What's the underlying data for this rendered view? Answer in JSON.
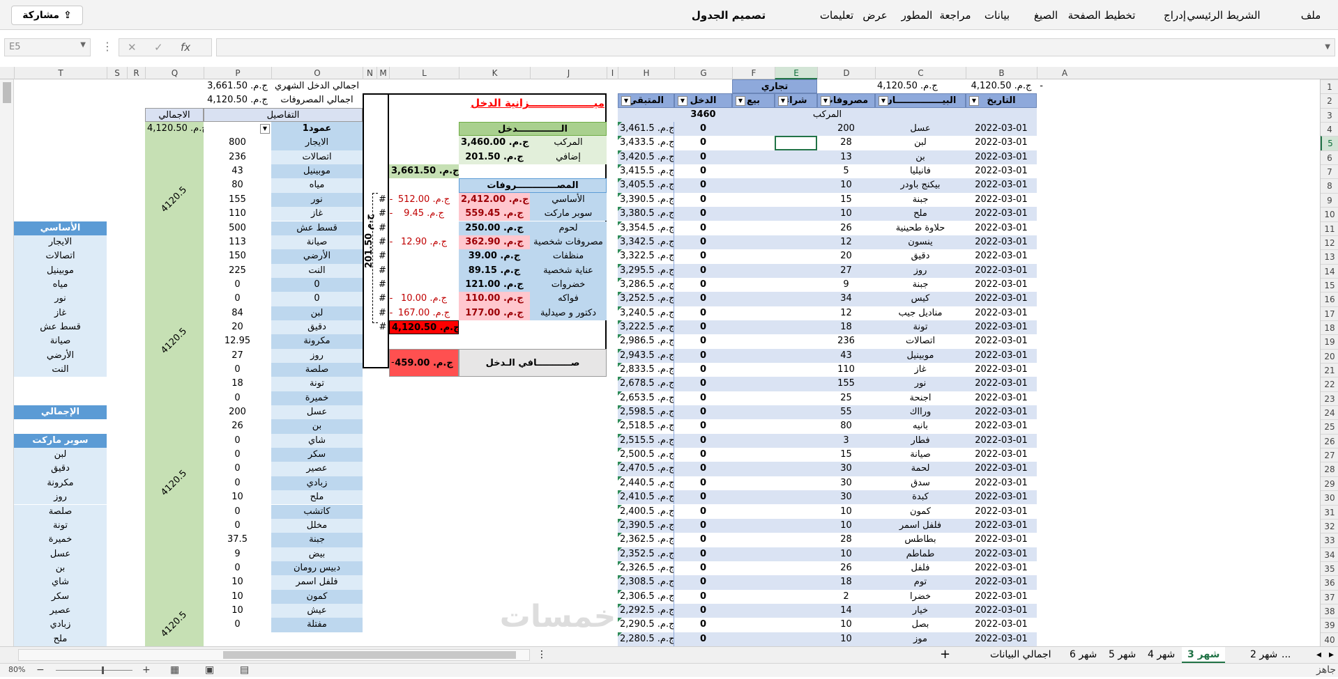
{
  "ribbon": {
    "share_label": "مشاركة",
    "tabs": [
      "ملف",
      "الشريط الرئيسي",
      "إدراج",
      "تخطيط الصفحة",
      "الصيغ",
      "بيانات",
      "مراجعة",
      "المطور",
      "عرض",
      "تعليمات",
      "تصميم الجدول"
    ]
  },
  "formula_bar": {
    "name_box": "E5",
    "cancel": "✕",
    "confirm": "✓",
    "fx": "fx",
    "value": ""
  },
  "columns": [
    "A",
    "B",
    "C",
    "D",
    "E",
    "F",
    "G",
    "H",
    "I",
    "J",
    "K",
    "L",
    "M",
    "N",
    "O",
    "P",
    "Q",
    "R",
    "S",
    "T"
  ],
  "rows": [
    "1",
    "2",
    "3",
    "4",
    "5",
    "6",
    "7",
    "8",
    "9",
    "10",
    "11",
    "12",
    "13",
    "14",
    "15",
    "16",
    "17",
    "18",
    "19",
    "20",
    "21",
    "22",
    "23",
    "24",
    "25",
    "26",
    "27",
    "28",
    "29",
    "30",
    "31",
    "32",
    "33",
    "34",
    "35",
    "36",
    "37",
    "38",
    "39",
    "40"
  ],
  "selected_cell": {
    "column": "E",
    "row": "5"
  },
  "top_summary": {
    "income_label": "اجمالي الدخل الشهري",
    "income_value": "ج.م. 3,661.50",
    "expenses_label": "اجمالي المصروفات",
    "expenses_value": "ج.م. 4,120.50",
    "balance_value": "ج.م. 4,120.50",
    "balance_dash": "-",
    "net_value": "ج.م. 459.00",
    "net_dash": "-",
    "commercial": "تجاري"
  },
  "main_table": {
    "headers": [
      "التاريخ",
      "البيـــــــــــــــان",
      "مصروفات",
      "شراء",
      "بيع",
      "الدخل",
      "المتبقي"
    ],
    "subheader": "المركب",
    "g3_value": "3460",
    "rows": [
      [
        "2022-03-01",
        "عسل",
        "200",
        "",
        "",
        "0",
        "ج.م. 3,461.5"
      ],
      [
        "2022-03-01",
        "لبن",
        "28",
        "",
        "",
        "0",
        "ج.م. 3,433.5"
      ],
      [
        "2022-03-01",
        "بن",
        "13",
        "",
        "",
        "0",
        "ج.م. 3,420.5"
      ],
      [
        "2022-03-01",
        "فانيليا",
        "5",
        "",
        "",
        "0",
        "ج.م. 3,415.5"
      ],
      [
        "2022-03-01",
        "بيكنج باودر",
        "10",
        "",
        "",
        "0",
        "ج.م. 3,405.5"
      ],
      [
        "2022-03-01",
        "جبنة",
        "15",
        "",
        "",
        "0",
        "ج.م. 3,390.5"
      ],
      [
        "2022-03-01",
        "ملح",
        "10",
        "",
        "",
        "0",
        "ج.م. 3,380.5"
      ],
      [
        "2022-03-01",
        "حلاوة طحينية",
        "26",
        "",
        "",
        "0",
        "ج.م. 3,354.5"
      ],
      [
        "2022-03-01",
        "ينسون",
        "12",
        "",
        "",
        "0",
        "ج.م. 3,342.5"
      ],
      [
        "2022-03-01",
        "دقيق",
        "20",
        "",
        "",
        "0",
        "ج.م. 3,322.5"
      ],
      [
        "2022-03-01",
        "روز",
        "27",
        "",
        "",
        "0",
        "ج.م. 3,295.5"
      ],
      [
        "2022-03-01",
        "جبنة",
        "9",
        "",
        "",
        "0",
        "ج.م. 3,286.5"
      ],
      [
        "2022-03-01",
        "كيس",
        "34",
        "",
        "",
        "0",
        "ج.م. 3,252.5"
      ],
      [
        "2022-03-01",
        "مناديل جيب",
        "12",
        "",
        "",
        "0",
        "ج.م. 3,240.5"
      ],
      [
        "2022-03-01",
        "تونة",
        "18",
        "",
        "",
        "0",
        "ج.م. 3,222.5"
      ],
      [
        "2022-03-01",
        "اتصالات",
        "236",
        "",
        "",
        "0",
        "ج.م. 2,986.5"
      ],
      [
        "2022-03-01",
        "موبينيل",
        "43",
        "",
        "",
        "0",
        "ج.م. 2,943.5"
      ],
      [
        "2022-03-01",
        "غاز",
        "110",
        "",
        "",
        "0",
        "ج.م. 2,833.5"
      ],
      [
        "2022-03-01",
        "نور",
        "155",
        "",
        "",
        "0",
        "ج.م. 2,678.5"
      ],
      [
        "2022-03-01",
        "اجنحة",
        "25",
        "",
        "",
        "0",
        "ج.م. 2,653.5"
      ],
      [
        "2022-03-01",
        "ورااك",
        "55",
        "",
        "",
        "0",
        "ج.م. 2,598.5"
      ],
      [
        "2022-03-01",
        "بانيه",
        "80",
        "",
        "",
        "0",
        "ج.م. 2,518.5"
      ],
      [
        "2022-03-01",
        "فطار",
        "3",
        "",
        "",
        "0",
        "ج.م. 2,515.5"
      ],
      [
        "2022-03-01",
        "صيانة",
        "15",
        "",
        "",
        "0",
        "ج.م. 2,500.5"
      ],
      [
        "2022-03-01",
        "لحمة",
        "30",
        "",
        "",
        "0",
        "ج.م. 2,470.5"
      ],
      [
        "2022-03-01",
        "سدق",
        "30",
        "",
        "",
        "0",
        "ج.م. 2,440.5"
      ],
      [
        "2022-03-01",
        "كبدة",
        "30",
        "",
        "",
        "0",
        "ج.م. 2,410.5"
      ],
      [
        "2022-03-01",
        "كمون",
        "10",
        "",
        "",
        "0",
        "ج.م. 2,400.5"
      ],
      [
        "2022-03-01",
        "فلفل اسمر",
        "10",
        "",
        "",
        "0",
        "ج.م. 2,390.5"
      ],
      [
        "2022-03-01",
        "بطاطس",
        "28",
        "",
        "",
        "0",
        "ج.م. 2,362.5"
      ],
      [
        "2022-03-01",
        "طماطم",
        "10",
        "",
        "",
        "0",
        "ج.م. 2,352.5"
      ],
      [
        "2022-03-01",
        "فلفل",
        "26",
        "",
        "",
        "0",
        "ج.م. 2,326.5"
      ],
      [
        "2022-03-01",
        "توم",
        "18",
        "",
        "",
        "0",
        "ج.م. 2,308.5"
      ],
      [
        "2022-03-01",
        "خضرا",
        "2",
        "",
        "",
        "0",
        "ج.م. 2,306.5"
      ],
      [
        "2022-03-01",
        "خيار",
        "14",
        "",
        "",
        "0",
        "ج.م. 2,292.5"
      ],
      [
        "2022-03-01",
        "بصل",
        "10",
        "",
        "",
        "0",
        "ج.م. 2,290.5"
      ],
      [
        "2022-03-01",
        "موز",
        "10",
        "",
        "",
        "0",
        "ج.م. 2,280.5"
      ]
    ]
  },
  "budget": {
    "title": "ميــــــــــــــــــزانية الدخل",
    "income_header": "الــــــــــــــدخل",
    "income_rows": [
      [
        "المركب",
        "ج.م. 3,460.00"
      ],
      [
        "إضافي",
        "ج.م. 201.50"
      ]
    ],
    "income_total": "ج.م. 3,661.50",
    "expenses_header": "المصـــــــــــــروفات",
    "expense_rows": [
      [
        "الأساسي",
        "ج.م. 2,412.00",
        "ج.م. 512.00",
        "-"
      ],
      [
        "سوبر ماركت",
        "ج.م. 559.45",
        "ج.م. 9.45",
        "-"
      ],
      [
        "لحوم",
        "ج.م. 250.00",
        "",
        ""
      ],
      [
        "مصروفات شخصية",
        "ج.م. 362.90",
        "ج.م. 12.90",
        "-"
      ],
      [
        "منظفات",
        "ج.م. 39.00",
        "",
        ""
      ],
      [
        "عناية شخصية",
        "ج.م. 89.15",
        "",
        ""
      ],
      [
        "خضروات",
        "ج.م. 121.00",
        "",
        ""
      ],
      [
        "فواكه",
        "ج.م. 110.00",
        "ج.م. 10.00",
        "-"
      ],
      [
        "دكتور و صيدلية",
        "ج.م. 177.00",
        "ج.م. 167.00",
        "-"
      ]
    ],
    "expenses_total": "ج.م. 4,120.50",
    "net_label": "صـــــــــــافي الـدخل",
    "net_value": "ج.م. 459.00",
    "net_dash": "-",
    "vertical_value": "201.50 ج.م.",
    "hash": "#"
  },
  "details": {
    "header_details": "التفاصيل",
    "header_total": "الاجمالي",
    "column_label": "عمود1",
    "total_value": "ج.م. 4,120.50",
    "merged_value": "4120.5",
    "rows": [
      [
        "الايجار",
        "800"
      ],
      [
        "اتصالات",
        "236"
      ],
      [
        "موبينيل",
        "43"
      ],
      [
        "مياه",
        "80"
      ],
      [
        "نور",
        "155"
      ],
      [
        "غاز",
        "110"
      ],
      [
        "قسط عش",
        "500"
      ],
      [
        "صيانة",
        "113"
      ],
      [
        "الأرضي",
        "150"
      ],
      [
        "النت",
        "225"
      ],
      [
        "0",
        "0"
      ],
      [
        "0",
        "0"
      ],
      [
        "لبن",
        "84"
      ],
      [
        "دقيق",
        "20"
      ],
      [
        "مكرونة",
        "12.95"
      ],
      [
        "روز",
        "27"
      ],
      [
        "صلصة",
        "0"
      ],
      [
        "تونة",
        "18"
      ],
      [
        "خميرة",
        "0"
      ],
      [
        "عسل",
        "200"
      ],
      [
        "بن",
        "26"
      ],
      [
        "شاي",
        "0"
      ],
      [
        "سكر",
        "0"
      ],
      [
        "عصير",
        "0"
      ],
      [
        "زبادي",
        "0"
      ],
      [
        "ملح",
        "10"
      ],
      [
        "كاتشب",
        "0"
      ],
      [
        "مخلل",
        "0"
      ],
      [
        "جبنة",
        "37.5"
      ],
      [
        "بيض",
        "9"
      ],
      [
        "دبيس رومان",
        "0"
      ],
      [
        "فلفل اسمر",
        "10"
      ],
      [
        "كمون",
        "10"
      ],
      [
        "عيش",
        "10"
      ],
      [
        "مفتلة",
        "0"
      ]
    ]
  },
  "column_t": {
    "rows": [
      {
        "row": "11",
        "text": "الأساسي",
        "style": "header"
      },
      {
        "row": "12",
        "text": "الايجار"
      },
      {
        "row": "13",
        "text": "اتصالات"
      },
      {
        "row": "14",
        "text": "موبينيل"
      },
      {
        "row": "15",
        "text": "مياه"
      },
      {
        "row": "16",
        "text": "نور"
      },
      {
        "row": "17",
        "text": "غاز"
      },
      {
        "row": "18",
        "text": "قسط عش"
      },
      {
        "row": "19",
        "text": "صيانة"
      },
      {
        "row": "20",
        "text": "الأرضي"
      },
      {
        "row": "21",
        "text": "النت"
      },
      {
        "row": "24",
        "text": "الإجمالي",
        "style": "header"
      },
      {
        "row": "26",
        "text": "سوبر ماركت",
        "style": "header"
      },
      {
        "row": "27",
        "text": "لبن"
      },
      {
        "row": "28",
        "text": "دقيق"
      },
      {
        "row": "29",
        "text": "مكرونة"
      },
      {
        "row": "30",
        "text": "روز"
      },
      {
        "row": "31",
        "text": "صلصة"
      },
      {
        "row": "32",
        "text": "تونة"
      },
      {
        "row": "33",
        "text": "خميرة"
      },
      {
        "row": "34",
        "text": "عسل"
      },
      {
        "row": "35",
        "text": "بن"
      },
      {
        "row": "36",
        "text": "شاي"
      },
      {
        "row": "37",
        "text": "سكر"
      },
      {
        "row": "38",
        "text": "عصير"
      },
      {
        "row": "39",
        "text": "زبادي"
      },
      {
        "row": "40",
        "text": "ملح"
      }
    ]
  },
  "sheet_tabs": [
    "شهر 2",
    "شهر 3",
    "شهر 4",
    "شهر 5",
    "شهر 6",
    "اجمالي البيانات"
  ],
  "active_sheet": "شهر 3",
  "more_tabs": "...",
  "add_sheet": "+",
  "status": {
    "zoom": "80%",
    "minus": "−",
    "plus": "+",
    "ready": "جاهز"
  },
  "watermark": "خمسات",
  "colors": {
    "header_blue": "#8ea9db",
    "row_alt": "#dae3f3",
    "green_header": "#a9d08e",
    "green_light": "#e2efda",
    "green_total": "#c6e0b4",
    "light_blue": "#bdd7ee",
    "pink": "#ffc7ce",
    "red": "#ff0000",
    "gray_net": "#e7e6e6",
    "excel_green": "#217346"
  }
}
